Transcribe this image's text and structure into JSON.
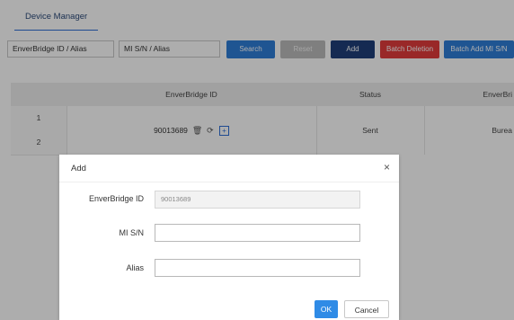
{
  "tabs": {
    "device_manager": "Device Manager"
  },
  "toolbar": {
    "enverbridge_field": "EnverBridge ID / Alias",
    "mi_field": "MI S/N / Alias",
    "search": "Search",
    "reset": "Reset",
    "add": "Add",
    "batch_deletion": "Batch Deletion",
    "batch_add": "Batch Add MI S/N"
  },
  "table": {
    "headers": {
      "enverbridge_id": "EnverBridge ID",
      "status": "Status",
      "enverbridge_cut": "EnverBri"
    },
    "rows": [
      "1",
      "2"
    ],
    "enverbridge_id": "90013689",
    "status": "Sent",
    "location": "Burea"
  },
  "modal": {
    "title": "Add",
    "close": "×",
    "fields": {
      "enverbridge_label": "EnverBridge ID",
      "enverbridge_value": "90013689",
      "mi_label": "MI S/N",
      "mi_value": "",
      "alias_label": "Alias",
      "alias_value": ""
    },
    "ok": "OK",
    "cancel": "Cancel"
  },
  "colors": {
    "primary": "#2f7ed8",
    "dark_blue": "#1f3f7a",
    "danger": "#e23b3b",
    "overlay": "rgba(0,0,0,0.32)"
  },
  "icons": [
    "trash-icon",
    "refresh-icon",
    "plus-square-icon",
    "close-icon"
  ]
}
